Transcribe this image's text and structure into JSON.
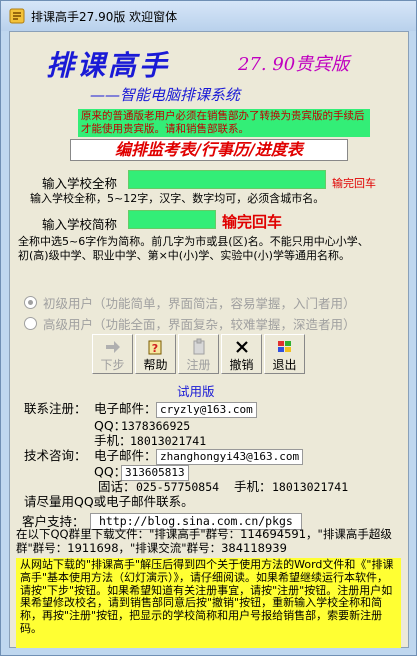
{
  "window": {
    "title": "排课高手27.90版 欢迎窗体"
  },
  "header": {
    "brand": "排课高手",
    "edition": "27. 90贵宾版",
    "subtitle": "——智能电脑排课系统"
  },
  "notices": {
    "upgrade": "原来的普通版老用户必须在销售部办了转换为贵宾版的手续后才能使用贵宾版。请和销售部联系。",
    "features": "编排监考表/行事历/进度表"
  },
  "form": {
    "full_name_label": "输入学校全称",
    "full_name_value": "",
    "full_name_hint": "输完回车",
    "full_name_desc": "输入学校全称，5~12字，汉字、数字均可，必须含城市名。",
    "short_name_label": "输入学校简称",
    "short_name_value": "",
    "short_name_hint": "输完回车",
    "short_name_desc_1": "全称中选5~6字作为简称。前几字为市或县(区)名。不能只用中心小学、",
    "short_name_desc_2": "初(高)级中学、职业中学、第×中(小)学、实验中(小)学等通用名称。"
  },
  "modes": [
    {
      "label": "初级用户（功能简单，界面简洁，容易掌握，入门者用）",
      "checked": true
    },
    {
      "label": "高级用户（功能全面，界面复杂，较难掌握，深造者用）",
      "checked": false
    }
  ],
  "toolbar": {
    "next_label": "下步",
    "help_label": "帮助",
    "register_label": "注册",
    "undo_label": "撤销",
    "exit_label": "退出"
  },
  "trial_label": "试用版",
  "contact": {
    "register_label": "联系注册：",
    "register_email_label": "电子邮件：",
    "register_email": "cryzly@163.com",
    "register_qq_label": "QQ：",
    "register_qq": "1378366925",
    "register_phone_label": "手机：",
    "register_phone": "18013021741",
    "tech_label": "技术咨询：",
    "tech_email_label": "电子邮件：",
    "tech_email": "zhanghongyi43@163.com",
    "tech_qq_label": "QQ：",
    "tech_qq": "313605813",
    "tech_tel_label": "固话：",
    "tech_tel": "025-57750854",
    "tech_mobile_label": "手机：",
    "tech_mobile": "18013021741",
    "advice": "请尽量用QQ或电子邮件联系。"
  },
  "support": {
    "label": "客户支持：",
    "url": "http://blog.sina.com.cn/pkgs"
  },
  "qq_groups": "在以下QQ群里下载文件：\"排课高手\"群号：114694591，\"排课高手超级群\"群号：1911698，\"排课交流\"群号：384118939",
  "instructions": "    从网站下载的\"排课高手\"解压后得到四个关于使用方法的Word文件和《\"排课高手\"基本使用方法（幻灯演示）》，请仔细阅读。如果希望继续运行本软件，请按\"下步\"按钮。如果希望知道有关注册事宜，请按\"注册\"按钮。注册用户如果希望修改校名，请到销售部同意后按\"撤销\"按钮，重新输入学校全称和简称，再按\"注册\"按钮，把显示的学校简称和用户号报给销售部，索要新注册码。",
  "colors": {
    "brand_blue": "#1a1ad6",
    "edition_magenta": "#c000c0",
    "alert_red": "#e00000",
    "input_green": "#33ee77",
    "notice_yellow": "#ffff33"
  }
}
